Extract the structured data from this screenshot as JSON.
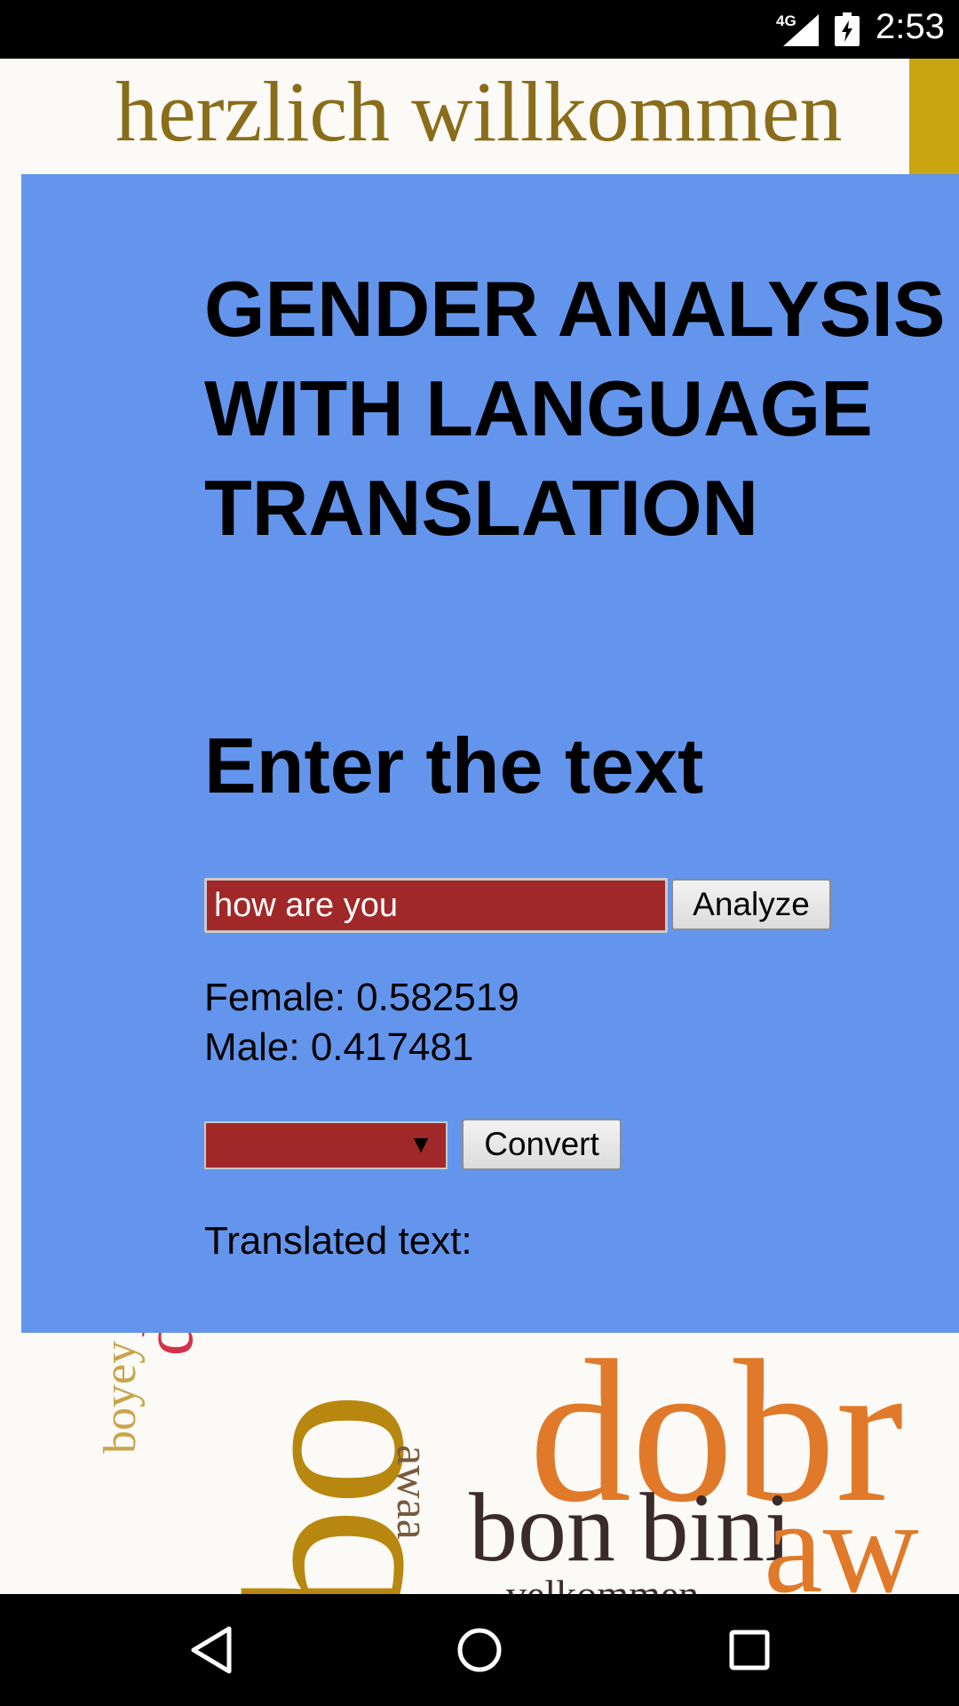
{
  "status_bar": {
    "network": "4G",
    "time": "2:53"
  },
  "background_words": [
    "herzlich willkommen",
    "dobro",
    "boyey",
    "bo",
    "awaa",
    "dobr",
    "bon bini",
    "aw",
    "velkommen"
  ],
  "app": {
    "title": "GENDER ANALYSIS WITH LANGUAGE TRANSLATION",
    "prompt": "Enter the text",
    "input": {
      "value": "how are you",
      "placeholder": ""
    },
    "analyze_label": "Analyze",
    "results": {
      "female": "Female: 0.582519",
      "male": "Male: 0.417481"
    },
    "language_select": {
      "selected": ""
    },
    "convert_label": "Convert",
    "translated_label": "Translated text:"
  },
  "colors": {
    "panel": "#6495ec",
    "input_bg": "#a12828"
  }
}
